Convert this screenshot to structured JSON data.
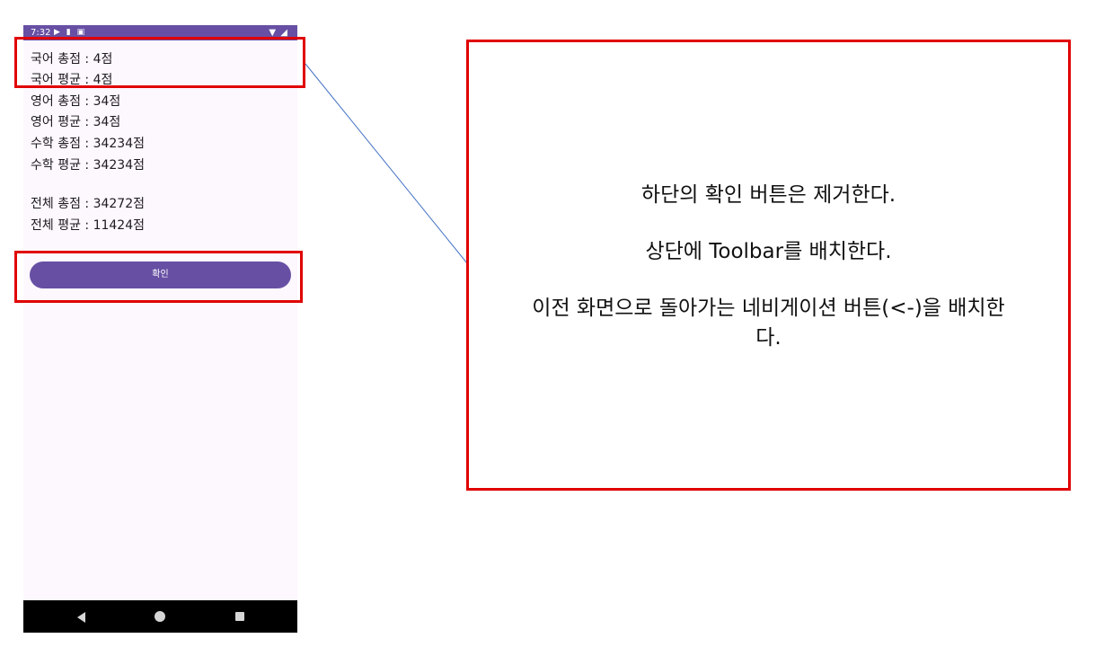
{
  "status_bar": {
    "time": "7:32",
    "left_icons": [
      "play-protect-icon",
      "sim-card-icon",
      "notification-icon"
    ],
    "right_icons": [
      "wifi-icon",
      "signal-icon"
    ]
  },
  "scores": [
    {
      "label": "국어 총점 : 4점"
    },
    {
      "label": "국어 평균 : 4점"
    },
    {
      "label": "영어 총점 : 34점"
    },
    {
      "label": "영어 평균 : 34점"
    },
    {
      "label": "수학 총점 : 34234점"
    },
    {
      "label": "수학 평균 : 34234점"
    },
    {
      "label": "전체 총점 : 34272점"
    },
    {
      "label": "전체 평균 : 11424점"
    }
  ],
  "confirm_button": {
    "label": "확인"
  },
  "nav_bar": {
    "buttons": [
      "back-icon",
      "home-icon",
      "recents-icon"
    ]
  },
  "annotation": {
    "line1": "하단의 확인 버튼은 제거한다.",
    "line2": "상단에 Toolbar를 배치한다.",
    "line3": "이전 화면으로 돌아가는 네비게이션 버튼(<-)을 배치한",
    "line4": "다."
  },
  "colors": {
    "accent": "#6750a4",
    "background": "#fdf7fe",
    "highlight": "#e00000",
    "connector": "#4472c4"
  }
}
